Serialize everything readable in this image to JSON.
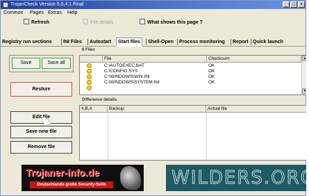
{
  "window": {
    "title": "TrojanCheck Version 5.0.4.1 Final"
  },
  "menu": [
    "Common",
    "Pages",
    "Extras",
    "Help"
  ],
  "toolbar": {
    "refresh": "Refresh",
    "file_details": "File details",
    "what_shows": "What shows this page ?"
  },
  "tabs": [
    "Registry run sections",
    "INI Files",
    "Autostart",
    "Start files",
    "Shell-Open",
    "Process monitoring",
    "Report",
    "Quick launch"
  ],
  "active_tab": "Start files",
  "buttons": {
    "save": "Save",
    "save_all": "Save all",
    "restore": "Restore",
    "edit_file": "Edit file",
    "save_new_file": "Save new file",
    "remove_file": "Remove file"
  },
  "files_panel": {
    "title": "6 Files",
    "columns": [
      "File",
      "Checksum"
    ],
    "rows": [
      {
        "file": "C:\\AUTOEXEC.BAT",
        "checksum": "OK"
      },
      {
        "file": "C:\\CONFIG.SYS",
        "checksum": "OK"
      },
      {
        "file": "C:\\WINDOWS\\WIN.INI",
        "checksum": "OK"
      },
      {
        "file": "C:\\WINDOWS\\SYSTEM.INI",
        "checksum": "OK"
      }
    ]
  },
  "diff_panel": {
    "title": "Difference details",
    "columns": [
      "#,B,A",
      "Backup",
      "Actual file"
    ]
  },
  "banners": {
    "trojaner_title": "Trojaner-info.de",
    "trojaner_sub": "Deutschlands große Security-Seite",
    "wilders": "WILDERS.ORG"
  },
  "colors": {
    "title_bar": "#1f3f9b",
    "green_button_border": "#3ea43e",
    "red_button_border": "#d24a4a",
    "smiley": "#f5d020",
    "wilders_bg": "#1e5a63",
    "trojaner_red": "#d81818"
  }
}
